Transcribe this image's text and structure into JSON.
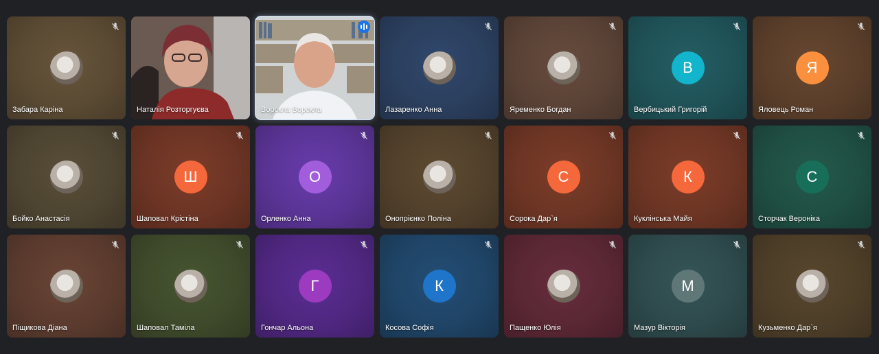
{
  "participants": [
    {
      "name": "Забара Каріна",
      "type": "photo",
      "bg": "#5a4a33",
      "mic_muted": true
    },
    {
      "name": "Наталія Розторгуєва",
      "type": "video",
      "bg": "#5b4b44",
      "mic_muted": false
    },
    {
      "name": "Ворскла Ворскла",
      "type": "video",
      "bg": "#bfc4c6",
      "mic_muted": false,
      "speaking": true
    },
    {
      "name": "Лазаренко Анна",
      "type": "photo",
      "bg": "#2b3f5e",
      "mic_muted": true
    },
    {
      "name": "Яременко Богдан",
      "type": "photo",
      "bg": "#5a4236",
      "mic_muted": true
    },
    {
      "name": "Вербицький Григорій",
      "type": "letter",
      "letter": "В",
      "avatar_color": "#12b5cb",
      "bg": "#1f5257",
      "mic_muted": true
    },
    {
      "name": "Яловець Роман",
      "type": "letter",
      "letter": "Я",
      "avatar_color": "#fa903e",
      "bg": "#5a3e2a",
      "mic_muted": true
    },
    {
      "name": "Бойко Анастасія",
      "type": "photo",
      "bg": "#4d4431",
      "mic_muted": true
    },
    {
      "name": "Шаповал Крістіна",
      "type": "letter",
      "letter": "Ш",
      "avatar_color": "#f4683b",
      "bg": "#6c3424",
      "mic_muted": true
    },
    {
      "name": "Орленко Анна",
      "type": "letter",
      "letter": "О",
      "avatar_color": "#a25ddc",
      "bg": "#5a3495",
      "mic_muted": true
    },
    {
      "name": "Онопрієнко Поліна",
      "type": "photo",
      "bg": "#51402b",
      "mic_muted": true
    },
    {
      "name": "Сорока Дар`я",
      "type": "letter",
      "letter": "С",
      "avatar_color": "#f4683b",
      "bg": "#6c3524",
      "mic_muted": true
    },
    {
      "name": "Куклінська Майя",
      "type": "letter",
      "letter": "К",
      "avatar_color": "#f4683b",
      "bg": "#6c3524",
      "mic_muted": true
    },
    {
      "name": "Сторчак Вероніка",
      "type": "letter",
      "letter": "С",
      "avatar_color": "#176f5a",
      "bg": "#1f4e42",
      "mic_muted": true
    },
    {
      "name": "Піщикова Діана",
      "type": "photo",
      "bg": "#5b3b2e",
      "mic_muted": true
    },
    {
      "name": "Шаповал Таміла",
      "type": "photo",
      "bg": "#3e4a2b",
      "mic_muted": true
    },
    {
      "name": "Гончар Альона",
      "type": "letter",
      "letter": "Г",
      "avatar_color": "#9c3bc0",
      "bg": "#4f2780",
      "mic_muted": true
    },
    {
      "name": "Косова Софія",
      "type": "letter",
      "letter": "К",
      "avatar_color": "#1f75c9",
      "bg": "#1f4466",
      "mic_muted": true
    },
    {
      "name": "Пащенко Юлія",
      "type": "photo",
      "bg": "#5a2734",
      "mic_muted": true
    },
    {
      "name": "Мазур Вікторія",
      "type": "letter",
      "letter": "М",
      "avatar_color": "#5f7777",
      "bg": "#2e4a4c",
      "mic_muted": true
    },
    {
      "name": "Кузьменко Дар`я",
      "type": "photo",
      "bg": "#4d3e28",
      "mic_muted": true
    }
  ]
}
